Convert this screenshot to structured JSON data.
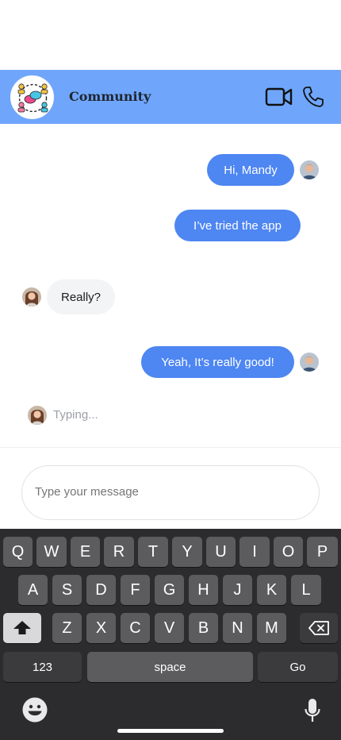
{
  "header": {
    "title": "Community",
    "colors": {
      "header_bg": "#6fa6fb",
      "outgoing_bubble": "#4e86f2",
      "incoming_bubble": "#f3f4f6"
    },
    "icons": [
      "community-group-icon",
      "video-camera-icon",
      "phone-icon"
    ]
  },
  "messages": [
    {
      "direction": "outgoing",
      "text": "Hi, Mandy",
      "avatar": true
    },
    {
      "direction": "outgoing",
      "text": "I’ve tried the app",
      "avatar": false
    },
    {
      "direction": "incoming",
      "text": "Really?",
      "avatar": true
    },
    {
      "direction": "outgoing",
      "text": "Yeah, It’s really good!",
      "avatar": true
    }
  ],
  "typing": {
    "text": "Typing..."
  },
  "composer": {
    "placeholder": "Type your message"
  },
  "keyboard": {
    "row1": [
      "Q",
      "W",
      "E",
      "R",
      "T",
      "Y",
      "U",
      "I",
      "O",
      "P"
    ],
    "row2": [
      "A",
      "S",
      "D",
      "F",
      "G",
      "H",
      "J",
      "K",
      "L"
    ],
    "row3": [
      "Z",
      "X",
      "C",
      "V",
      "B",
      "N",
      "M"
    ],
    "numbers_label": "123",
    "space_label": "space",
    "go_label": "Go",
    "icons": [
      "shift-icon",
      "backspace-icon",
      "emoji-icon",
      "microphone-icon"
    ]
  }
}
